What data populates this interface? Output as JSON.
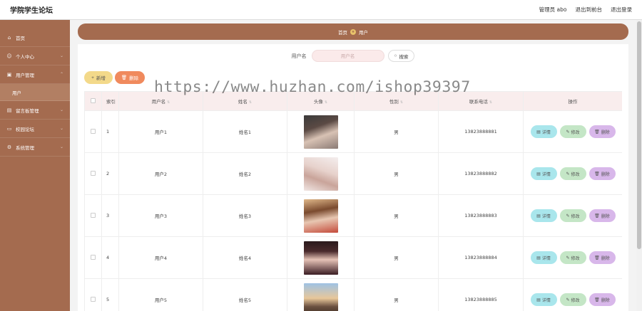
{
  "app": {
    "title": "学院学生论坛"
  },
  "topbar": {
    "admin": "管理员 abo",
    "back": "退出到前台",
    "logout": "退出登录"
  },
  "sidebar": {
    "items": [
      {
        "label": "首页",
        "icon": "home-icon"
      },
      {
        "label": "个人中心",
        "icon": "user-icon"
      },
      {
        "label": "用户管理",
        "icon": "users-icon"
      },
      {
        "label": "留言板管理",
        "icon": "message-icon"
      },
      {
        "label": "校园论坛",
        "icon": "forum-icon"
      },
      {
        "label": "系统管理",
        "icon": "gear-icon"
      }
    ],
    "sub_item": "用户"
  },
  "breadcrumb": {
    "home": "首页",
    "current": "用户"
  },
  "search": {
    "label": "用户名",
    "placeholder": "用户名",
    "button": "搜索"
  },
  "actions": {
    "add": "新增",
    "delete": "删除"
  },
  "table": {
    "headers": {
      "index": "索引",
      "username": "用户名",
      "name": "姓名",
      "avatar": "头像",
      "gender": "性别",
      "phone": "联系电话",
      "ops": "操作"
    },
    "rows": [
      {
        "index": "1",
        "username": "用户1",
        "name": "姓名1",
        "gender": "男",
        "phone": "13823888881"
      },
      {
        "index": "2",
        "username": "用户2",
        "name": "姓名2",
        "gender": "男",
        "phone": "13823888882"
      },
      {
        "index": "3",
        "username": "用户3",
        "name": "姓名3",
        "gender": "男",
        "phone": "13823888883"
      },
      {
        "index": "4",
        "username": "用户4",
        "name": "姓名4",
        "gender": "男",
        "phone": "13823888884"
      },
      {
        "index": "5",
        "username": "用户5",
        "name": "姓名5",
        "gender": "男",
        "phone": "13823888885"
      }
    ],
    "op_labels": {
      "detail": "详情",
      "edit": "修改",
      "delete": "删除"
    }
  },
  "watermark": "https://www.huzhan.com/ishop39397",
  "colors": {
    "brand": "#a46b4f",
    "add": "#f3d98a",
    "delete": "#f08a5d",
    "detail": "#a9e6ec",
    "edit": "#c4e6c6",
    "row_delete": "#d8b7ea"
  }
}
